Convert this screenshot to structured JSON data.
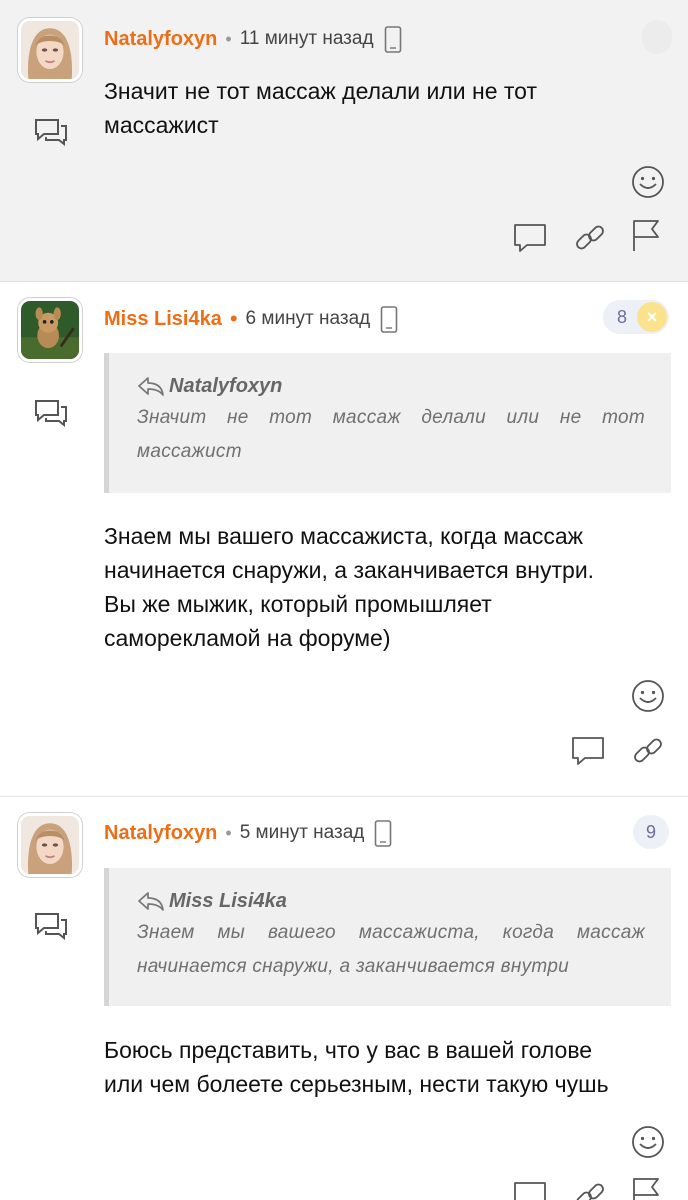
{
  "colors": {
    "author": "#ee6d15",
    "rating_bg": "#eef0f7",
    "rating_cancel": "#fbe38d",
    "first_bg": "#f2f2f2"
  },
  "comments": [
    {
      "author": "Natalyfoxyn",
      "time": "11 минут назад",
      "device_icon": "mobile-phone-icon",
      "text_lines": [
        "Значит не тот массаж делали или не тот",
        "массажист"
      ]
    },
    {
      "author": "Miss Lisi4ka",
      "time": "6 минут назад",
      "device_icon": "mobile-phone-icon",
      "rating": "8",
      "rating_cancel": "×",
      "quote": {
        "author": "Natalyfoxyn",
        "lines": [
          "Значит не тот массаж делали или не тот",
          "массажист"
        ]
      },
      "text_lines": [
        "Знаем мы вашего массажиста, когда массаж",
        "начинается снаружи, а заканчивается внутри.",
        "Вы же мыжик, который промышляет",
        "саморекламой на форуме)"
      ]
    },
    {
      "author": "Natalyfoxyn",
      "time": "5 минут назад",
      "device_icon": "mobile-phone-icon",
      "rating": "9",
      "quote": {
        "author": "Miss Lisi4ka",
        "lines": [
          "Знаем мы вашего массажиста, когда массаж",
          "начинается снаружи, а заканчивается внутри"
        ]
      },
      "text_lines": [
        "Боюсь представить, что у вас в вашей голове",
        "или чем болеете серьезным, нести такую чушь"
      ]
    }
  ],
  "separator": "•"
}
